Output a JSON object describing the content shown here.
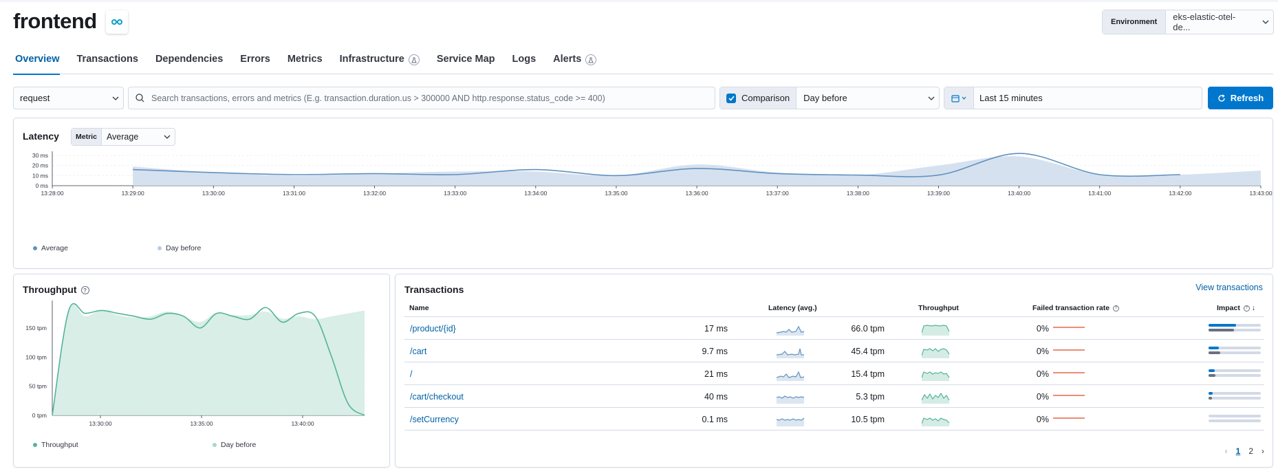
{
  "header": {
    "title": "frontend",
    "agent_icon": "opentelemetry-icon",
    "environment_label": "Environment",
    "environment_value": "eks-elastic-otel-de..."
  },
  "tabs": [
    {
      "label": "Overview",
      "active": true
    },
    {
      "label": "Transactions"
    },
    {
      "label": "Dependencies"
    },
    {
      "label": "Errors"
    },
    {
      "label": "Metrics"
    },
    {
      "label": "Infrastructure",
      "beta": true
    },
    {
      "label": "Service Map"
    },
    {
      "label": "Logs"
    },
    {
      "label": "Alerts",
      "beta": true
    }
  ],
  "filters": {
    "transaction_type": "request",
    "search_placeholder": "Search transactions, errors and metrics (E.g. transaction.duration.us > 300000 AND http.response.status_code >= 400)",
    "comparison_label": "Comparison",
    "comparison_checked": true,
    "comparison_value": "Day before",
    "time_range": "Last 15 minutes",
    "refresh_label": "Refresh"
  },
  "colors": {
    "accent": "#0077cc",
    "latency_line": "#6092c0",
    "latency_area": "#cfdcec",
    "throughput_line": "#54b399",
    "throughput_area": "#d4ece4",
    "failed_rate": "#e7664c"
  },
  "latency": {
    "title": "Latency",
    "metric_label": "Metric",
    "metric_value": "Average",
    "legend": [
      "Average",
      "Day before"
    ]
  },
  "throughput": {
    "title": "Throughput",
    "legend": [
      "Throughput",
      "Day before"
    ]
  },
  "transactions": {
    "title": "Transactions",
    "view_link": "View transactions",
    "columns": {
      "name": "Name",
      "latency": "Latency (avg.)",
      "throughput": "Throughput",
      "failed": "Failed transaction rate",
      "impact": "Impact"
    },
    "rows": [
      {
        "name": "/product/{id}",
        "latency": "17 ms",
        "throughput": "66.0 tpm",
        "failed": "0%",
        "impact": 0.53,
        "impact_cmp": 0.49
      },
      {
        "name": "/cart",
        "latency": "9.7 ms",
        "throughput": "45.4 tpm",
        "failed": "0%",
        "impact": 0.2,
        "impact_cmp": 0.22
      },
      {
        "name": "/",
        "latency": "21 ms",
        "throughput": "15.4 tpm",
        "failed": "0%",
        "impact": 0.12,
        "impact_cmp": 0.13
      },
      {
        "name": "/cart/checkout",
        "latency": "40 ms",
        "throughput": "5.3 tpm",
        "failed": "0%",
        "impact": 0.08,
        "impact_cmp": 0.07
      },
      {
        "name": "/setCurrency",
        "latency": "0.1 ms",
        "throughput": "10.5 tpm",
        "failed": "0%",
        "impact": 0.0,
        "impact_cmp": 0.0
      }
    ],
    "pages": [
      "1",
      "2"
    ],
    "current_page": "1"
  },
  "chart_data": [
    {
      "type": "area",
      "title": "Latency",
      "x_ticks": [
        "13:28:00",
        "13:29:00",
        "13:30:00",
        "13:31:00",
        "13:32:00",
        "13:33:00",
        "13:34:00",
        "13:35:00",
        "13:36:00",
        "13:37:00",
        "13:38:00",
        "13:39:00",
        "13:40:00",
        "13:41:00",
        "13:42:00",
        "13:43:00"
      ],
      "y_ticks": [
        "0 ms",
        "10 ms",
        "20 ms",
        "30 ms"
      ],
      "ylim": [
        0,
        30
      ],
      "series": [
        {
          "name": "Average",
          "x": [
            "13:29:00",
            "13:30:00",
            "13:31:00",
            "13:32:00",
            "13:33:00",
            "13:34:00",
            "13:35:00",
            "13:36:00",
            "13:37:00",
            "13:38:00",
            "13:39:00",
            "13:40:00",
            "13:41:00",
            "13:42:00"
          ],
          "values": [
            16,
            13,
            11,
            12,
            11,
            16,
            10,
            17,
            12,
            10.5,
            10.5,
            32,
            11,
            11
          ]
        },
        {
          "name": "Day before",
          "x": [
            "13:29:00",
            "13:30:00",
            "13:31:00",
            "13:32:00",
            "13:33:00",
            "13:34:00",
            "13:35:00",
            "13:36:00",
            "13:37:00",
            "13:38:00",
            "13:39:00",
            "13:40:00",
            "13:41:00",
            "13:42:00",
            "13:43:00"
          ],
          "values": [
            19,
            13,
            10,
            12,
            14,
            14,
            10,
            21,
            13,
            10.5,
            20,
            29,
            11,
            11,
            15
          ]
        }
      ],
      "legend": [
        "Average",
        "Day before"
      ],
      "grid": true
    },
    {
      "type": "area",
      "title": "Throughput",
      "x_ticks": [
        "13:30:00",
        "13:35:00",
        "13:40:00"
      ],
      "y_ticks": [
        "0 tpm",
        "50 tpm",
        "100 tpm",
        "150 tpm"
      ],
      "ylim": [
        0,
        190
      ],
      "series": [
        {
          "name": "Throughput",
          "values": [
            0,
            180,
            175,
            180,
            175,
            170,
            165,
            175,
            170,
            150,
            175,
            170,
            165,
            185,
            160,
            175,
            170,
            100,
            20,
            0
          ]
        },
        {
          "name": "Day before",
          "values": [
            0,
            180,
            170,
            180,
            172,
            168,
            170,
            178,
            170,
            160,
            176,
            172,
            172,
            178,
            166,
            170,
            165,
            170,
            175,
            180
          ]
        }
      ],
      "legend": [
        "Throughput",
        "Day before"
      ],
      "grid": true
    }
  ]
}
